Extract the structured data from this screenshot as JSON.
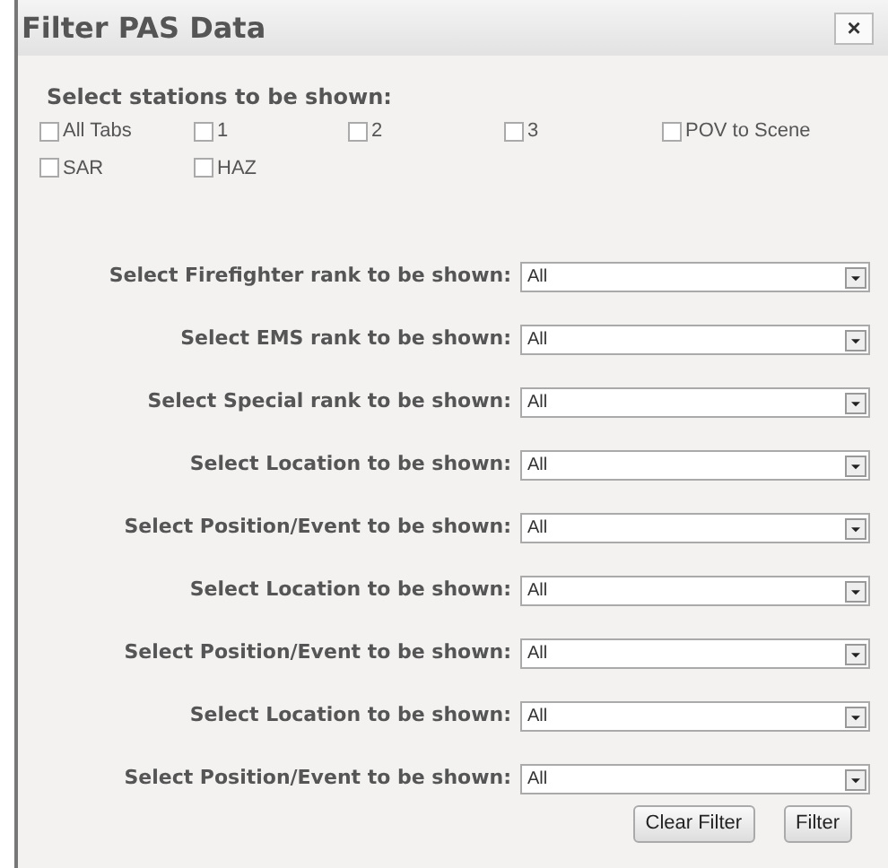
{
  "dialog": {
    "title": "Filter PAS Data",
    "close": "×"
  },
  "stations": {
    "heading": "Select stations to be shown:",
    "options": [
      {
        "label": "All Tabs",
        "checked": false
      },
      {
        "label": "1",
        "checked": false
      },
      {
        "label": "2",
        "checked": false
      },
      {
        "label": "3",
        "checked": false
      },
      {
        "label": "POV to Scene",
        "checked": false
      },
      {
        "label": "SAR",
        "checked": false
      },
      {
        "label": "HAZ",
        "checked": false
      }
    ]
  },
  "filters": [
    {
      "label": "Select Firefighter rank to be shown:",
      "value": "All"
    },
    {
      "label": "Select EMS rank to be shown:",
      "value": "All"
    },
    {
      "label": "Select Special rank to be shown:",
      "value": "All"
    },
    {
      "label": "Select Location to be shown:",
      "value": "All"
    },
    {
      "label": "Select Position/Event to be shown:",
      "value": "All"
    },
    {
      "label": "Select Location to be shown:",
      "value": "All"
    },
    {
      "label": "Select Position/Event to be shown:",
      "value": "All"
    },
    {
      "label": "Select Location to be shown:",
      "value": "All"
    },
    {
      "label": "Select Position/Event to be shown:",
      "value": "All"
    }
  ],
  "buttons": [
    "Clear Filter",
    "Filter"
  ]
}
